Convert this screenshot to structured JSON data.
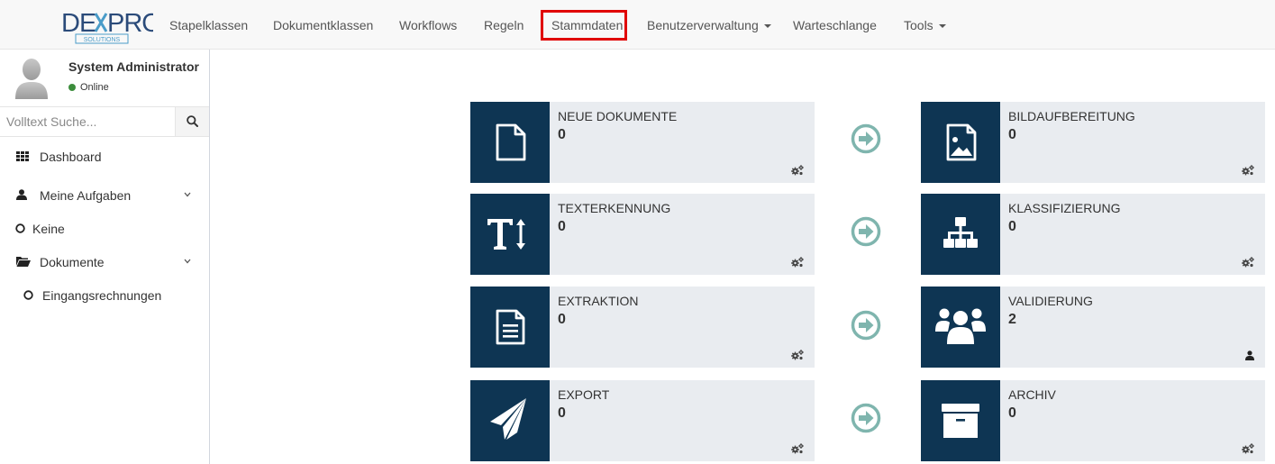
{
  "navbar": {
    "logo_text": "DEXPRO",
    "logo_subtext": "SOLUTIONS",
    "items": [
      {
        "label": "Stapelklassen"
      },
      {
        "label": "Dokumentklassen"
      },
      {
        "label": "Workflows"
      },
      {
        "label": "Regeln"
      },
      {
        "label": "Stammdaten",
        "highlighted": true
      },
      {
        "label": "Benutzerverwaltung",
        "dropdown": true
      },
      {
        "label": "Warteschlange"
      },
      {
        "label": "Tools",
        "dropdown": true
      }
    ],
    "highlight_color": "#e00000"
  },
  "sidebar": {
    "user": {
      "name": "System Administrator",
      "status": "Online",
      "status_color": "#3c8d3c"
    },
    "search": {
      "placeholder": "Volltext Suche...",
      "value": "",
      "icon": "search-icon"
    },
    "menu": [
      {
        "label": "Dashboard",
        "icon": "th-grid-icon"
      },
      {
        "label": "Meine Aufgaben",
        "icon": "user-icon",
        "expandable": true
      },
      {
        "label": "Keine",
        "icon": "circle-outline-icon",
        "sub": true
      },
      {
        "label": "Dokumente",
        "icon": "folder-open-icon",
        "expandable": true
      },
      {
        "label": "Eingangsrechnungen",
        "icon": "circle-outline-icon",
        "sub": true
      }
    ]
  },
  "dashboard": {
    "tile_color": "#e9ecf0",
    "icon_bg_color": "#0e3553",
    "arrow_color": "#7fb5ae",
    "tiles": [
      {
        "title": "Neue Dokumente",
        "count": "0",
        "icon": "file-icon",
        "action_icon": "cogs-icon"
      },
      {
        "title": "Bildaufbereitung",
        "count": "0",
        "icon": "file-image-icon",
        "action_icon": "cogs-icon"
      },
      {
        "title": "Texterkennung",
        "count": "0",
        "icon": "text-height-icon",
        "action_icon": "cogs-icon"
      },
      {
        "title": "Klassifizierung",
        "count": "0",
        "icon": "sitemap-icon",
        "action_icon": "cogs-icon"
      },
      {
        "title": "Extraktion",
        "count": "0",
        "icon": "file-text-icon",
        "action_icon": "cogs-icon"
      },
      {
        "title": "Validierung",
        "count": "2",
        "icon": "users-icon",
        "action_icon": "user-icon"
      },
      {
        "title": "Export",
        "count": "0",
        "icon": "paper-plane-icon",
        "action_icon": "cogs-icon"
      },
      {
        "title": "Archiv",
        "count": "0",
        "icon": "archive-icon",
        "action_icon": "cogs-icon"
      }
    ]
  }
}
